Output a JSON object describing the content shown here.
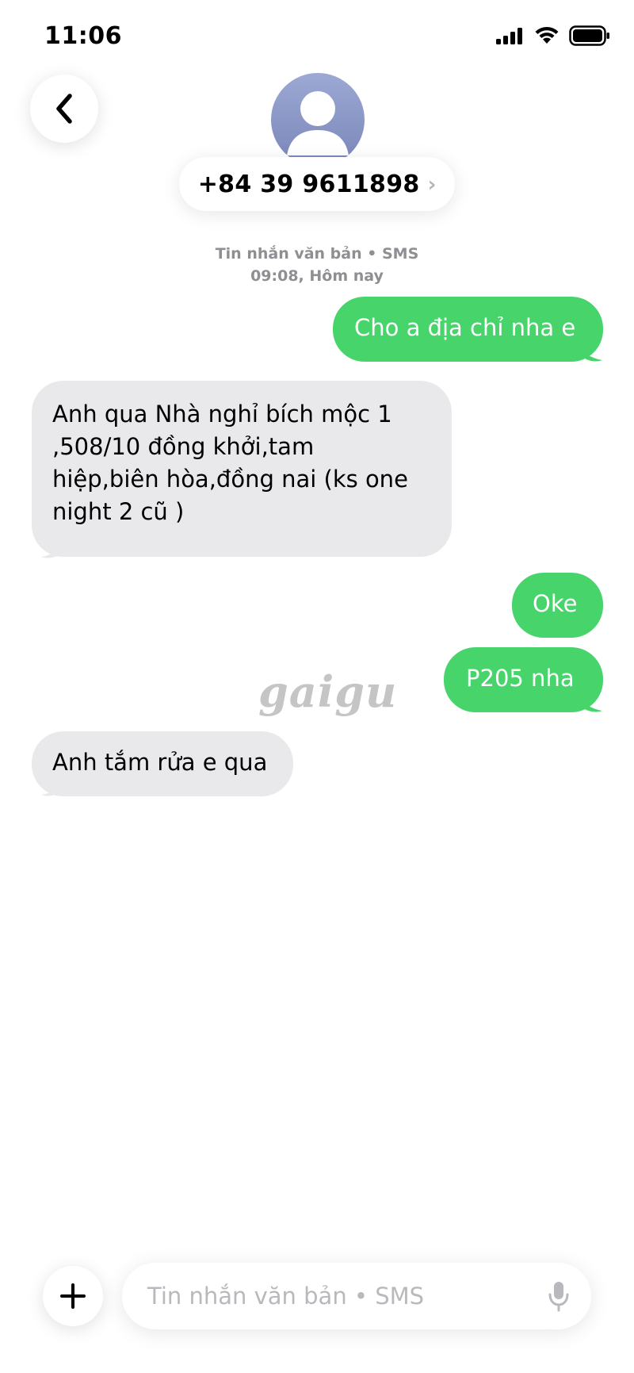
{
  "status_bar": {
    "time": "11:06",
    "icons": [
      "cellular-signal-icon",
      "wifi-icon",
      "battery-icon"
    ]
  },
  "header": {
    "back_icon": "chevron-left-icon",
    "avatar_icon": "person-silhouette-icon",
    "contact_number": "+84 39 9611898",
    "chevron": "›"
  },
  "thread": {
    "service_label": "Tin nhắn văn bản • SMS",
    "timestamp": "09:08, Hôm nay"
  },
  "messages": [
    {
      "direction": "out",
      "lines": [
        "Cho a địa chỉ nha e"
      ]
    },
    {
      "direction": "in",
      "lines": [
        "Anh qua Nhà nghỉ bích mộc 1",
        ",508/10 đồng khởi,tam",
        "hiệp,biên hòa,đồng nai (ks one",
        "night 2 cũ )"
      ]
    },
    {
      "direction": "out",
      "lines": [
        "Oke"
      ]
    },
    {
      "direction": "out",
      "lines": [
        "P205 nha"
      ]
    },
    {
      "direction": "in",
      "lines": [
        "Anh tắm rửa e qua"
      ]
    }
  ],
  "watermark": "gaigu",
  "composer": {
    "add_icon": "plus-icon",
    "placeholder": "Tin nhắn văn bản • SMS",
    "mic_icon": "microphone-icon"
  },
  "colors": {
    "outgoing_bubble": "#47d46b",
    "incoming_bubble": "#e9e9eb",
    "meta_text": "#8e8e93"
  }
}
